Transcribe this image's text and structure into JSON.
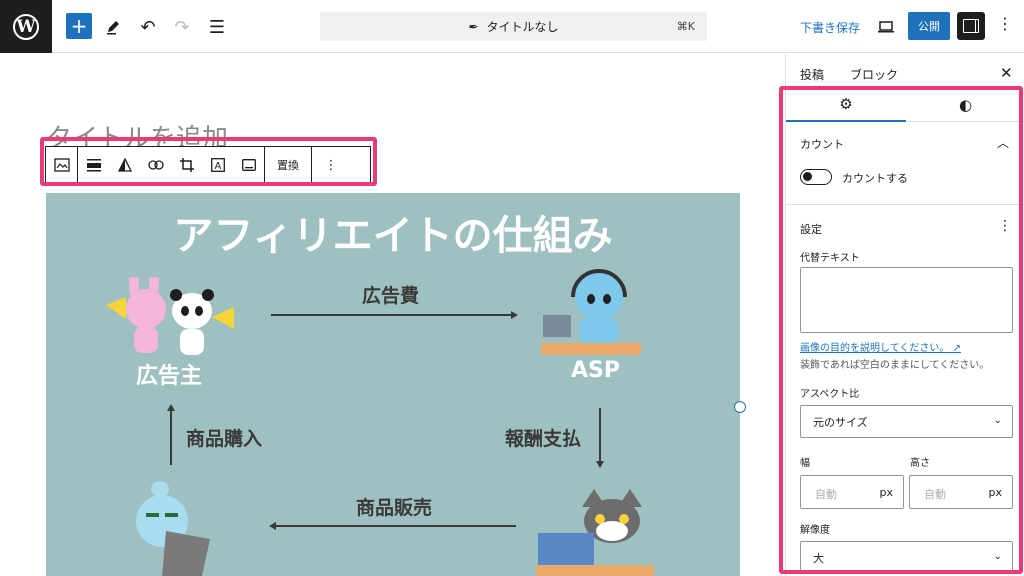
{
  "header": {
    "document_title": "タイトルなし",
    "shortcut": "⌘K",
    "save_draft": "下書き保存",
    "publish": "公開"
  },
  "editor": {
    "title_placeholder": "タイトルを追加",
    "block_toolbar": {
      "replace_label": "置換",
      "tools": [
        "image-icon",
        "align-icon",
        "duotone-icon",
        "link-icon",
        "crop-icon",
        "text-overlay-icon",
        "caption-icon"
      ]
    }
  },
  "image": {
    "title": "アフィリエイトの仕組み",
    "labels": {
      "ad_cost": "広告費",
      "payment": "報酬支払",
      "sales": "商品販売",
      "purchase": "商品購入"
    },
    "roles": {
      "advertiser": "広告主",
      "asp": "ASP"
    }
  },
  "sidebar": {
    "tabs": [
      "投稿",
      "ブロック"
    ],
    "count_section": "カウント",
    "count_toggle": "カウントする",
    "settings": "設定",
    "alt_label": "代替テキスト",
    "alt_link": "画像の目的を説明してください。",
    "alt_link_arrow": "↗",
    "alt_help": "装飾であれば空白のままにしてください。",
    "aspect_label": "アスペクト比",
    "aspect_value": "元のサイズ",
    "width_label": "幅",
    "height_label": "高さ",
    "width_placeholder": "自動",
    "height_placeholder": "自動",
    "unit": "px",
    "resolution_label": "解像度",
    "resolution_value": "大"
  },
  "colors": {
    "accent": "#1e72bd",
    "highlight": "#ea3a7a",
    "image_bg": "#9fc0c0"
  }
}
